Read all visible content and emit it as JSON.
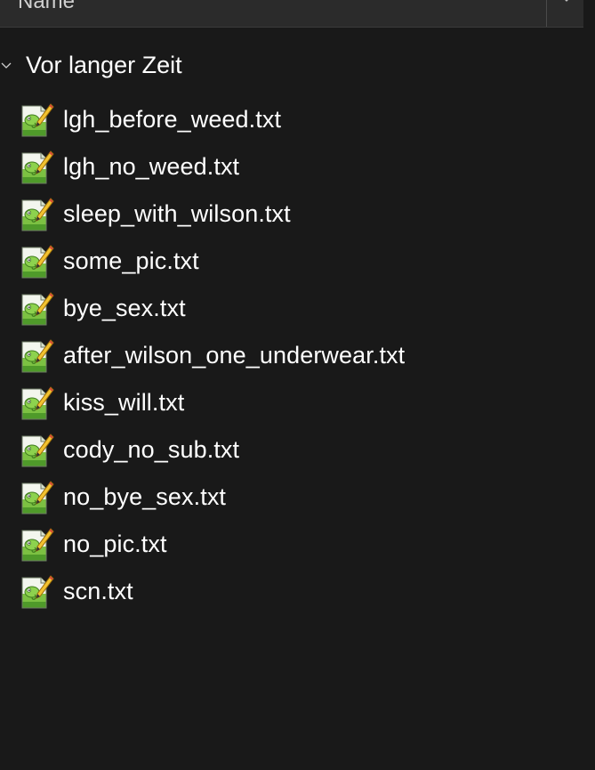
{
  "header": {
    "column_label": "Name"
  },
  "group": {
    "label": "Vor langer Zeit"
  },
  "files": [
    {
      "name": "lgh_before_weed.txt",
      "icon": "notepad-plus-plus-file-icon"
    },
    {
      "name": "lgh_no_weed.txt",
      "icon": "notepad-plus-plus-file-icon"
    },
    {
      "name": "sleep_with_wilson.txt",
      "icon": "notepad-plus-plus-file-icon"
    },
    {
      "name": "some_pic.txt",
      "icon": "notepad-plus-plus-file-icon"
    },
    {
      "name": "bye_sex.txt",
      "icon": "notepad-plus-plus-file-icon"
    },
    {
      "name": "after_wilson_one_underwear.txt",
      "icon": "notepad-plus-plus-file-icon"
    },
    {
      "name": "kiss_will.txt",
      "icon": "notepad-plus-plus-file-icon"
    },
    {
      "name": "cody_no_sub.txt",
      "icon": "notepad-plus-plus-file-icon"
    },
    {
      "name": "no_bye_sex.txt",
      "icon": "notepad-plus-plus-file-icon"
    },
    {
      "name": "no_pic.txt",
      "icon": "notepad-plus-plus-file-icon"
    },
    {
      "name": "scn.txt",
      "icon": "notepad-plus-plus-file-icon"
    }
  ],
  "colors": {
    "background": "#191919",
    "header_background": "#2b2b2b",
    "text": "#ffffff"
  }
}
